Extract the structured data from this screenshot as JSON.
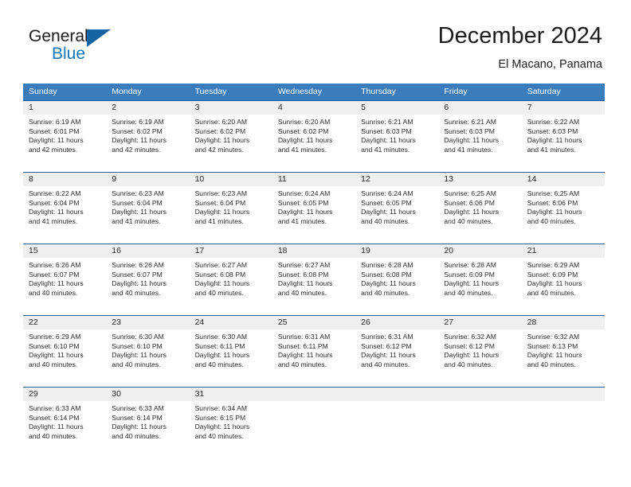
{
  "brand": {
    "name_part1": "General",
    "name_part2": "Blue"
  },
  "header": {
    "month_title": "December 2024",
    "location": "El Macano, Panama"
  },
  "colors": {
    "header_blue": "#3b7cbd",
    "week_divider_blue": "#2a6099",
    "daynum_band": "#efefef",
    "brand_blue": "#1274bd",
    "text": "#2b2b2b"
  },
  "weekdays": [
    "Sunday",
    "Monday",
    "Tuesday",
    "Wednesday",
    "Thursday",
    "Friday",
    "Saturday"
  ],
  "weeks": [
    [
      {
        "day": "1",
        "sunrise": "Sunrise: 6:19 AM",
        "sunset": "Sunset: 6:01 PM",
        "daylight1": "Daylight: 11 hours",
        "daylight2": "and 42 minutes."
      },
      {
        "day": "2",
        "sunrise": "Sunrise: 6:19 AM",
        "sunset": "Sunset: 6:02 PM",
        "daylight1": "Daylight: 11 hours",
        "daylight2": "and 42 minutes."
      },
      {
        "day": "3",
        "sunrise": "Sunrise: 6:20 AM",
        "sunset": "Sunset: 6:02 PM",
        "daylight1": "Daylight: 11 hours",
        "daylight2": "and 42 minutes."
      },
      {
        "day": "4",
        "sunrise": "Sunrise: 6:20 AM",
        "sunset": "Sunset: 6:02 PM",
        "daylight1": "Daylight: 11 hours",
        "daylight2": "and 41 minutes."
      },
      {
        "day": "5",
        "sunrise": "Sunrise: 6:21 AM",
        "sunset": "Sunset: 6:03 PM",
        "daylight1": "Daylight: 11 hours",
        "daylight2": "and 41 minutes."
      },
      {
        "day": "6",
        "sunrise": "Sunrise: 6:21 AM",
        "sunset": "Sunset: 6:03 PM",
        "daylight1": "Daylight: 11 hours",
        "daylight2": "and 41 minutes."
      },
      {
        "day": "7",
        "sunrise": "Sunrise: 6:22 AM",
        "sunset": "Sunset: 6:03 PM",
        "daylight1": "Daylight: 11 hours",
        "daylight2": "and 41 minutes."
      }
    ],
    [
      {
        "day": "8",
        "sunrise": "Sunrise: 6:22 AM",
        "sunset": "Sunset: 6:04 PM",
        "daylight1": "Daylight: 11 hours",
        "daylight2": "and 41 minutes."
      },
      {
        "day": "9",
        "sunrise": "Sunrise: 6:23 AM",
        "sunset": "Sunset: 6:04 PM",
        "daylight1": "Daylight: 11 hours",
        "daylight2": "and 41 minutes."
      },
      {
        "day": "10",
        "sunrise": "Sunrise: 6:23 AM",
        "sunset": "Sunset: 6:04 PM",
        "daylight1": "Daylight: 11 hours",
        "daylight2": "and 41 minutes."
      },
      {
        "day": "11",
        "sunrise": "Sunrise: 6:24 AM",
        "sunset": "Sunset: 6:05 PM",
        "daylight1": "Daylight: 11 hours",
        "daylight2": "and 41 minutes."
      },
      {
        "day": "12",
        "sunrise": "Sunrise: 6:24 AM",
        "sunset": "Sunset: 6:05 PM",
        "daylight1": "Daylight: 11 hours",
        "daylight2": "and 40 minutes."
      },
      {
        "day": "13",
        "sunrise": "Sunrise: 6:25 AM",
        "sunset": "Sunset: 6:06 PM",
        "daylight1": "Daylight: 11 hours",
        "daylight2": "and 40 minutes."
      },
      {
        "day": "14",
        "sunrise": "Sunrise: 6:25 AM",
        "sunset": "Sunset: 6:06 PM",
        "daylight1": "Daylight: 11 hours",
        "daylight2": "and 40 minutes."
      }
    ],
    [
      {
        "day": "15",
        "sunrise": "Sunrise: 6:26 AM",
        "sunset": "Sunset: 6:07 PM",
        "daylight1": "Daylight: 11 hours",
        "daylight2": "and 40 minutes."
      },
      {
        "day": "16",
        "sunrise": "Sunrise: 6:26 AM",
        "sunset": "Sunset: 6:07 PM",
        "daylight1": "Daylight: 11 hours",
        "daylight2": "and 40 minutes."
      },
      {
        "day": "17",
        "sunrise": "Sunrise: 6:27 AM",
        "sunset": "Sunset: 6:08 PM",
        "daylight1": "Daylight: 11 hours",
        "daylight2": "and 40 minutes."
      },
      {
        "day": "18",
        "sunrise": "Sunrise: 6:27 AM",
        "sunset": "Sunset: 6:08 PM",
        "daylight1": "Daylight: 11 hours",
        "daylight2": "and 40 minutes."
      },
      {
        "day": "19",
        "sunrise": "Sunrise: 6:28 AM",
        "sunset": "Sunset: 6:08 PM",
        "daylight1": "Daylight: 11 hours",
        "daylight2": "and 40 minutes."
      },
      {
        "day": "20",
        "sunrise": "Sunrise: 6:28 AM",
        "sunset": "Sunset: 6:09 PM",
        "daylight1": "Daylight: 11 hours",
        "daylight2": "and 40 minutes."
      },
      {
        "day": "21",
        "sunrise": "Sunrise: 6:29 AM",
        "sunset": "Sunset: 6:09 PM",
        "daylight1": "Daylight: 11 hours",
        "daylight2": "and 40 minutes."
      }
    ],
    [
      {
        "day": "22",
        "sunrise": "Sunrise: 6:29 AM",
        "sunset": "Sunset: 6:10 PM",
        "daylight1": "Daylight: 11 hours",
        "daylight2": "and 40 minutes."
      },
      {
        "day": "23",
        "sunrise": "Sunrise: 6:30 AM",
        "sunset": "Sunset: 6:10 PM",
        "daylight1": "Daylight: 11 hours",
        "daylight2": "and 40 minutes."
      },
      {
        "day": "24",
        "sunrise": "Sunrise: 6:30 AM",
        "sunset": "Sunset: 6:11 PM",
        "daylight1": "Daylight: 11 hours",
        "daylight2": "and 40 minutes."
      },
      {
        "day": "25",
        "sunrise": "Sunrise: 6:31 AM",
        "sunset": "Sunset: 6:11 PM",
        "daylight1": "Daylight: 11 hours",
        "daylight2": "and 40 minutes."
      },
      {
        "day": "26",
        "sunrise": "Sunrise: 6:31 AM",
        "sunset": "Sunset: 6:12 PM",
        "daylight1": "Daylight: 11 hours",
        "daylight2": "and 40 minutes."
      },
      {
        "day": "27",
        "sunrise": "Sunrise: 6:32 AM",
        "sunset": "Sunset: 6:12 PM",
        "daylight1": "Daylight: 11 hours",
        "daylight2": "and 40 minutes."
      },
      {
        "day": "28",
        "sunrise": "Sunrise: 6:32 AM",
        "sunset": "Sunset: 6:13 PM",
        "daylight1": "Daylight: 11 hours",
        "daylight2": "and 40 minutes."
      }
    ],
    [
      {
        "day": "29",
        "sunrise": "Sunrise: 6:33 AM",
        "sunset": "Sunset: 6:14 PM",
        "daylight1": "Daylight: 11 hours",
        "daylight2": "and 40 minutes."
      },
      {
        "day": "30",
        "sunrise": "Sunrise: 6:33 AM",
        "sunset": "Sunset: 6:14 PM",
        "daylight1": "Daylight: 11 hours",
        "daylight2": "and 40 minutes."
      },
      {
        "day": "31",
        "sunrise": "Sunrise: 6:34 AM",
        "sunset": "Sunset: 6:15 PM",
        "daylight1": "Daylight: 11 hours",
        "daylight2": "and 40 minutes."
      },
      {
        "day": "",
        "sunrise": "",
        "sunset": "",
        "daylight1": "",
        "daylight2": ""
      },
      {
        "day": "",
        "sunrise": "",
        "sunset": "",
        "daylight1": "",
        "daylight2": ""
      },
      {
        "day": "",
        "sunrise": "",
        "sunset": "",
        "daylight1": "",
        "daylight2": ""
      },
      {
        "day": "",
        "sunrise": "",
        "sunset": "",
        "daylight1": "",
        "daylight2": ""
      }
    ]
  ]
}
